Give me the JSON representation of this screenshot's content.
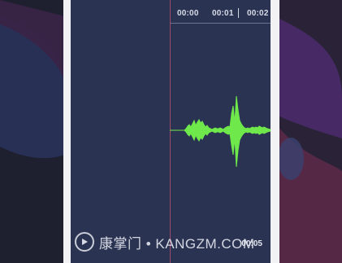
{
  "timeline": {
    "marks": [
      "00:00",
      "00:01",
      "00:02"
    ],
    "end_time": "00:05"
  },
  "watermark": {
    "text": "康掌门 • KANGZM.COM",
    "icon": "play-circle-icon"
  },
  "colors": {
    "screen_bg": "#2a3452",
    "waveform": "#6ee84a",
    "playhead": "#b05070"
  }
}
